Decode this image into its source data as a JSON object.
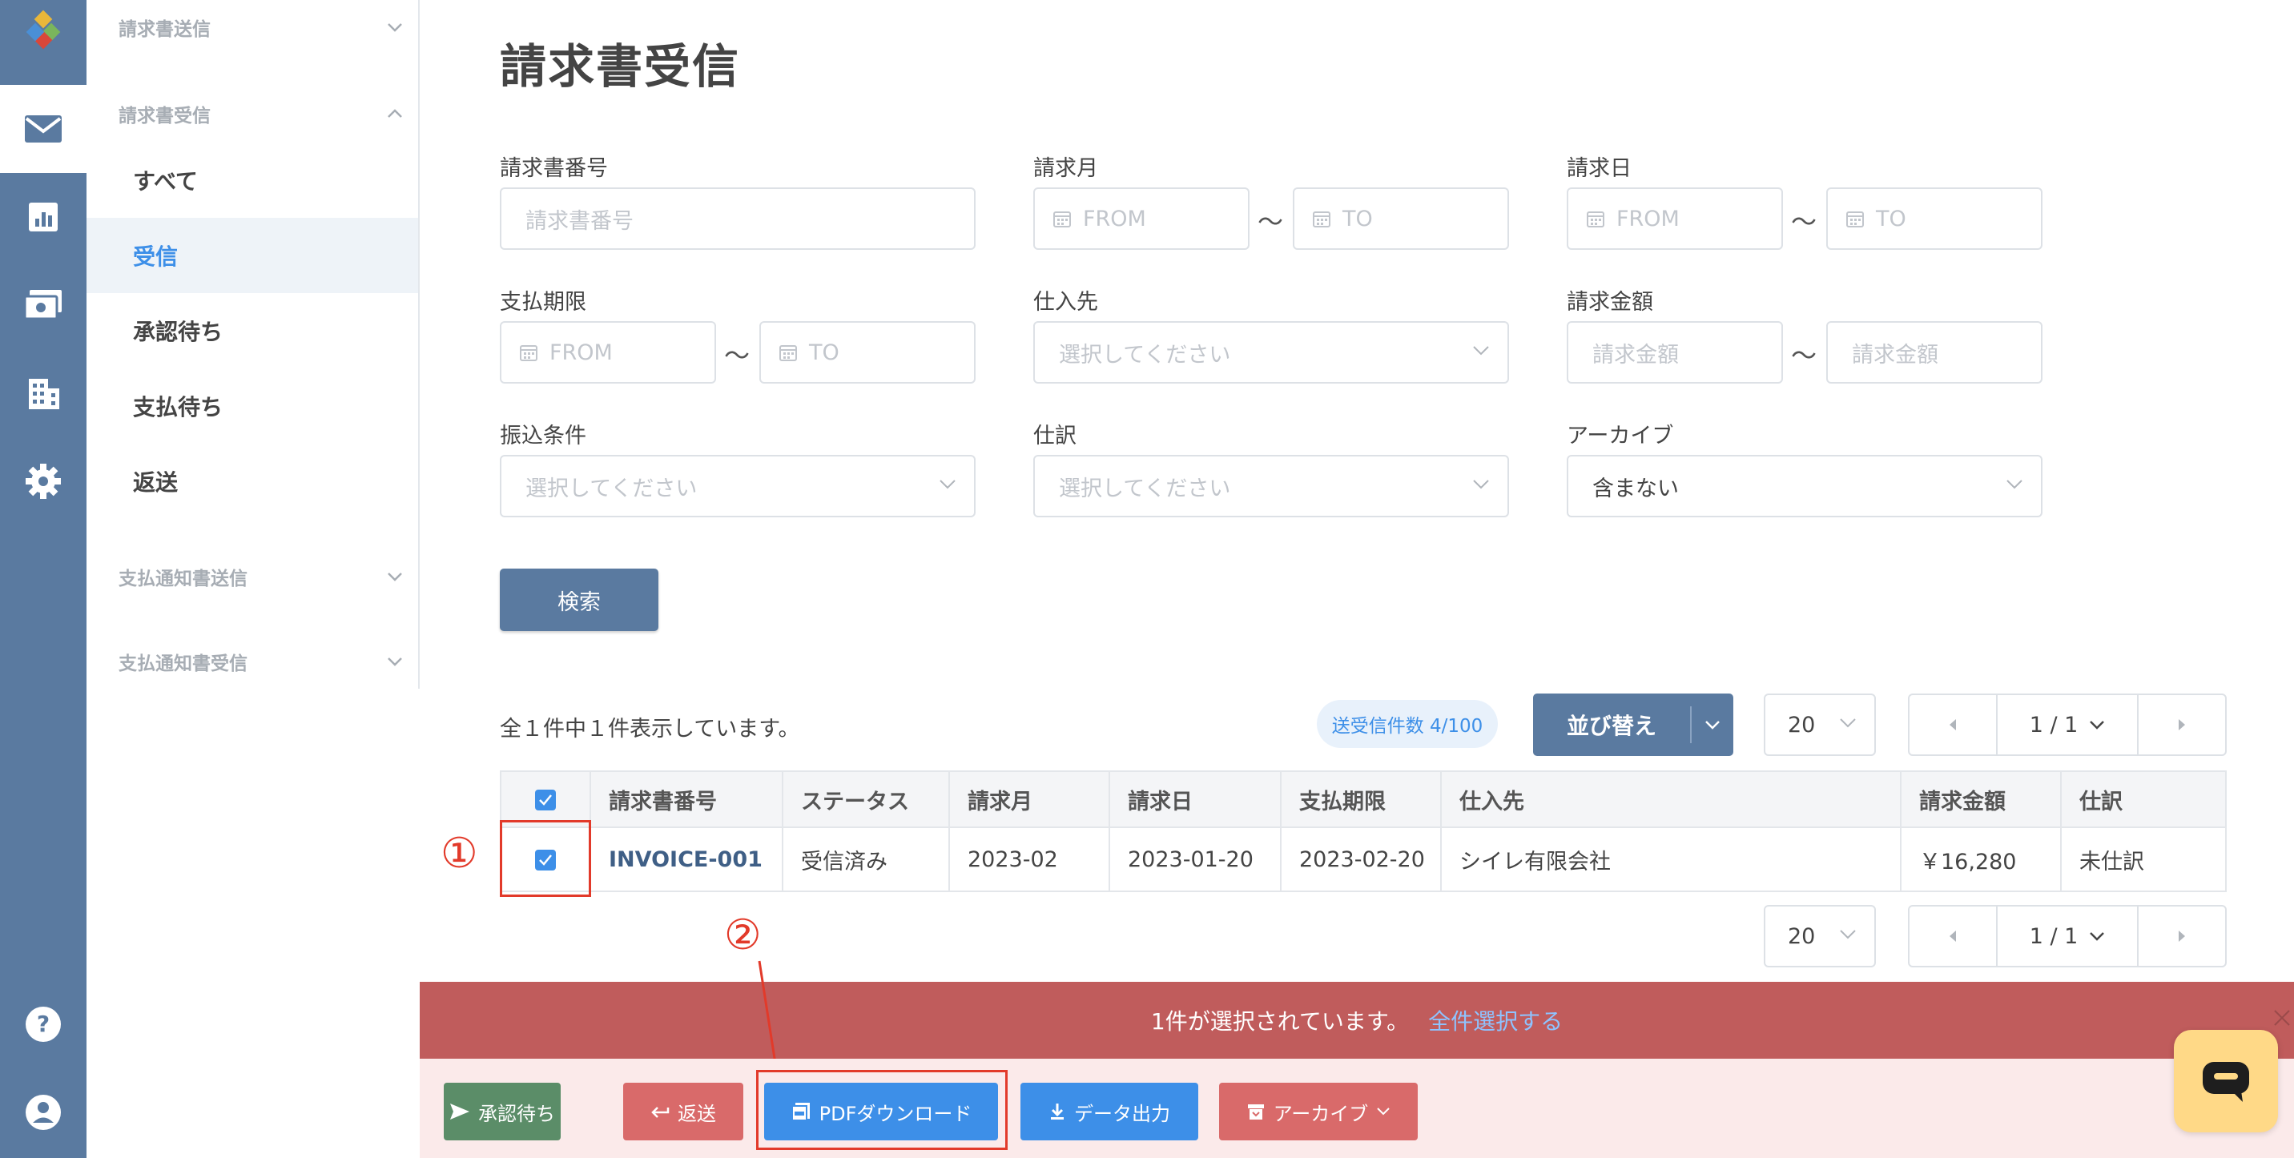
{
  "sidebar": {
    "groups": [
      {
        "label": "請求書送信"
      },
      {
        "label": "請求書受信"
      },
      {
        "label": "支払通知書送信"
      },
      {
        "label": "支払通知書受信"
      }
    ],
    "items": [
      {
        "label": "すべて"
      },
      {
        "label": "受信"
      },
      {
        "label": "承認待ち"
      },
      {
        "label": "支払待ち"
      },
      {
        "label": "返送"
      }
    ],
    "active_item": "受信"
  },
  "rail": {
    "icons": [
      "logo-icon",
      "mail-icon",
      "chart-icon",
      "payment-icon",
      "building-icon",
      "gear-icon",
      "help-icon",
      "account-icon"
    ]
  },
  "page": {
    "title": "請求書受信"
  },
  "filters": {
    "invoice_no": {
      "label": "請求書番号",
      "placeholder": "請求書番号"
    },
    "invoice_month": {
      "label": "請求月",
      "from": "FROM",
      "to": "TO"
    },
    "invoice_date": {
      "label": "請求日",
      "from": "FROM",
      "to": "TO"
    },
    "due_date": {
      "label": "支払期限",
      "from": "FROM",
      "to": "TO"
    },
    "supplier": {
      "label": "仕入先",
      "placeholder": "選択してください"
    },
    "amount": {
      "label": "請求金額",
      "from_placeholder": "請求金額",
      "to_placeholder": "請求金額"
    },
    "transfer_terms": {
      "label": "振込条件",
      "placeholder": "選択してください"
    },
    "journal": {
      "label": "仕訳",
      "placeholder": "選択してください"
    },
    "archive": {
      "label": "アーカイブ",
      "value": "含まない"
    },
    "range_separator": "〜",
    "search_button": "検索"
  },
  "results": {
    "summary": "全１件中１件表示しています。",
    "count_badge": "送受信件数 4/100",
    "sort_label": "並び替え",
    "per_page": "20",
    "page": "1 / 1",
    "columns": [
      "請求書番号",
      "ステータス",
      "請求月",
      "請求日",
      "支払期限",
      "仕入先",
      "請求金額",
      "仕訳"
    ],
    "rows": [
      {
        "checked": true,
        "invoice_no": "INVOICE-001",
        "status": "受信済み",
        "month": "2023-02",
        "date": "2023-01-20",
        "due": "2023-02-20",
        "supplier": "シイレ有限会社",
        "amount": "￥16,280",
        "journal": "未仕訳"
      }
    ]
  },
  "annotations": {
    "marker1": "①",
    "marker2": "②"
  },
  "selection": {
    "text": "1件が選択されています。",
    "select_all": "全件選択する"
  },
  "actions": [
    {
      "label": "承認待ち",
      "color": "#5b8d68"
    },
    {
      "label": "返送",
      "color": "#d96a6a"
    },
    {
      "label": "PDFダウンロード",
      "color": "#3d8fe8"
    },
    {
      "label": "データ出力",
      "color": "#3d8fe8"
    },
    {
      "label": "アーカイブ",
      "color": "#d96a6a"
    }
  ],
  "colors": {
    "rail": "#5a7aa0",
    "accent": "#3d8fe8",
    "banner": "#c05c5c",
    "highlight": "#e23a2a"
  }
}
